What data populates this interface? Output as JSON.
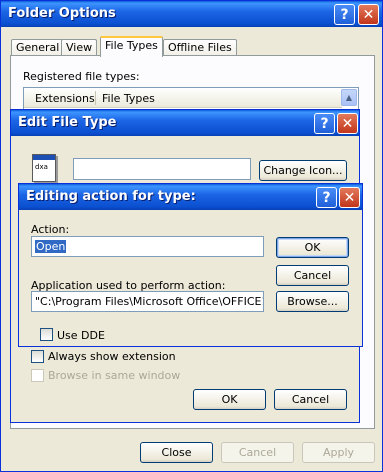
{
  "folder_options": {
    "title": "Folder Options",
    "tabs": [
      "General",
      "View",
      "File Types",
      "Offline Files"
    ],
    "registered_label": "Registered file types:",
    "columns": [
      "Extensions",
      "File Types"
    ],
    "buttons": {
      "close": "Close",
      "cancel": "Cancel",
      "apply": "Apply"
    }
  },
  "edit_file_type": {
    "title": "Edit File Type",
    "icon_text": "dxa",
    "change_icon": "Change Icon...",
    "always_show_extension": "Always show extension",
    "browse_same_window": "Browse in same window",
    "ok": "OK",
    "cancel": "Cancel"
  },
  "editing_action": {
    "title": "Editing action for type:",
    "action_label": "Action:",
    "action_value": "Open",
    "app_label": "Application used to perform action:",
    "app_value": "\"C:\\Program Files\\Microsoft Office\\OFFICE12\\",
    "use_dde": "Use DDE",
    "ok": "OK",
    "cancel": "Cancel",
    "browse": "Browse..."
  },
  "icons": {
    "help": "?",
    "close": "✕",
    "scroll_up": "▲"
  }
}
